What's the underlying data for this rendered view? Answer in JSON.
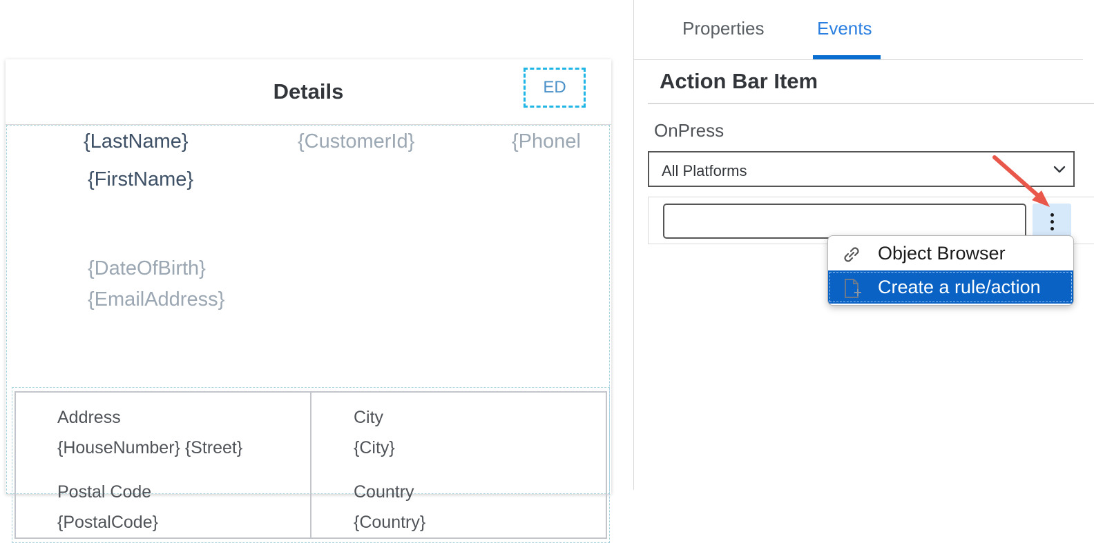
{
  "canvas": {
    "page_title": "Details",
    "action_button": "ED",
    "fields": {
      "last_name": "{LastName}",
      "customer_id": "{CustomerId}",
      "phone": "{Phonel",
      "first_name": "{FirstName}",
      "date_of_birth": "{DateOfBirth}",
      "email": "{EmailAddress}"
    },
    "address_section": {
      "address_label": "Address",
      "address_value": "{HouseNumber} {Street}",
      "city_label": "City",
      "city_value": "{City}",
      "postal_label": "Postal Code",
      "postal_value": "{PostalCode}",
      "country_label": "Country",
      "country_value": "{Country}"
    }
  },
  "panel": {
    "tabs": [
      "Properties",
      "Events"
    ],
    "active_tab": "Events",
    "section_title": "Action Bar Item",
    "event_label": "OnPress",
    "platform_select": "All Platforms",
    "rule_input_value": "",
    "menu_items": [
      {
        "label": "Object Browser",
        "icon": "link-icon"
      },
      {
        "label": "Create a rule/action",
        "icon": "new-file-icon",
        "highlighted": true
      }
    ]
  },
  "colors": {
    "accent": "#0a6ed1",
    "active_tab_text": "#2a7fe0",
    "highlight": "#0a63c4",
    "more_button_bg": "#d6e9fb",
    "arrow": "#e8574a",
    "ed_border": "#1fb6e6"
  }
}
